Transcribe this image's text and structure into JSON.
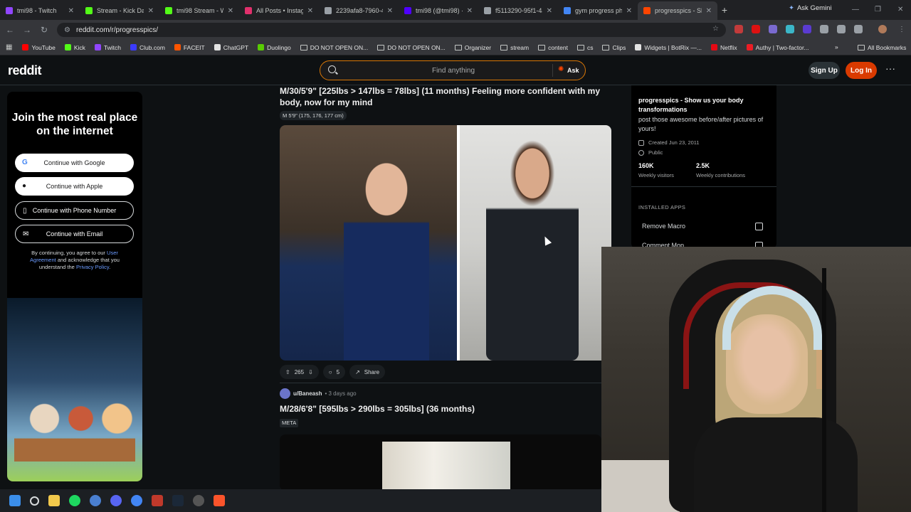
{
  "browser": {
    "tabs": [
      {
        "label": "tmi98 - Twitch",
        "color": "#9146ff"
      },
      {
        "label": "Stream - Kick Dash",
        "color": "#53fc18"
      },
      {
        "label": "tmi98 Stream - Wa",
        "color": "#53fc18"
      },
      {
        "label": "All Posts • Instagra",
        "color": "#e1306c"
      },
      {
        "label": "2239afa8-7960-40",
        "color": "#9aa0a6"
      },
      {
        "label": "tmi98 (@tmi98) · T",
        "color": "#4f00ff"
      },
      {
        "label": "f5113290-95f1-4a",
        "color": "#9aa0a6"
      },
      {
        "label": "gym progress phot",
        "color": "#4285f4"
      },
      {
        "label": "progresspics - Sho",
        "color": "#ff4500"
      }
    ],
    "new_tab": "+",
    "ask_gemini": "Ask Gemini",
    "url": "reddit.com/r/progresspics/",
    "bookmarks": [
      {
        "label": "YouTube",
        "type": "site",
        "color": "#ff0000"
      },
      {
        "label": "Kick",
        "type": "site",
        "color": "#53fc18"
      },
      {
        "label": "Twitch",
        "type": "site",
        "color": "#9146ff"
      },
      {
        "label": "Club.com",
        "type": "site",
        "color": "#3b3bff"
      },
      {
        "label": "FACEIT",
        "type": "site",
        "color": "#ff5500"
      },
      {
        "label": "ChatGPT",
        "type": "site",
        "color": "#e3e3e3"
      },
      {
        "label": "Duolingo",
        "type": "site",
        "color": "#58cc02"
      },
      {
        "label": "DO NOT OPEN ON...",
        "type": "folder"
      },
      {
        "label": "DO NOT OPEN ON...",
        "type": "folder"
      },
      {
        "label": "Organizer",
        "type": "folder"
      },
      {
        "label": "stream",
        "type": "folder"
      },
      {
        "label": "content",
        "type": "folder"
      },
      {
        "label": "cs",
        "type": "folder"
      },
      {
        "label": "Clips",
        "type": "folder"
      },
      {
        "label": "Widgets | BotRix —...",
        "type": "site",
        "color": "#e3e3e3"
      },
      {
        "label": "Netflix",
        "type": "site",
        "color": "#e50914"
      },
      {
        "label": "Authy | Two-factor...",
        "type": "site",
        "color": "#ec1c24"
      }
    ],
    "bookmarks_more": "»",
    "all_bookmarks": "All Bookmarks"
  },
  "reddit": {
    "logo": "reddit",
    "search_placeholder": "Find anything",
    "ask_label": "Ask",
    "signup_label": "Sign Up",
    "login_label": "Log In",
    "more": "···"
  },
  "auth_card": {
    "heading": "Join the most real place on the internet",
    "buttons": [
      {
        "label": "Continue with Google",
        "icon": "G"
      },
      {
        "label": "Continue with Apple",
        "icon": ""
      },
      {
        "label": "Continue with Phone Number",
        "icon": "▯"
      },
      {
        "label": "Continue with Email",
        "icon": "✉"
      }
    ],
    "legal_prefix": "By continuing, you agree to our",
    "legal_link1": "User Agreement",
    "legal_mid": "and acknowledge that you understand the",
    "legal_link2": "Privacy Policy",
    "legal_suffix": "."
  },
  "post1": {
    "title": "M/30/5'9\" [225lbs > 147lbs = 78lbs] (11 months) Feeling more confident with my body, now for my mind",
    "flair": "M 5'9\" (175, 176, 177 cm)",
    "votes": "265",
    "comments": "5",
    "share": "Share"
  },
  "post2": {
    "author": "u/Baneash",
    "time": "• 3 days ago",
    "title": "M/28/6'8\" [595lbs > 290lbs = 305lbs] (36 months)",
    "flair": "META"
  },
  "subreddit": {
    "title": "progresspics - Show us your body transformations",
    "description": "post those awesome before/after pictures of yours!",
    "created": "Created Jun 23, 2011",
    "visibility": "Public",
    "weekly_visitors_value": "160K",
    "weekly_visitors_label": "Weekly visitors",
    "weekly_contrib_value": "2.5K",
    "weekly_contrib_label": "Weekly contributions",
    "installed_apps_heading": "INSTALLED APPS",
    "apps": [
      "Remove Macro",
      "Comment Mop"
    ]
  }
}
